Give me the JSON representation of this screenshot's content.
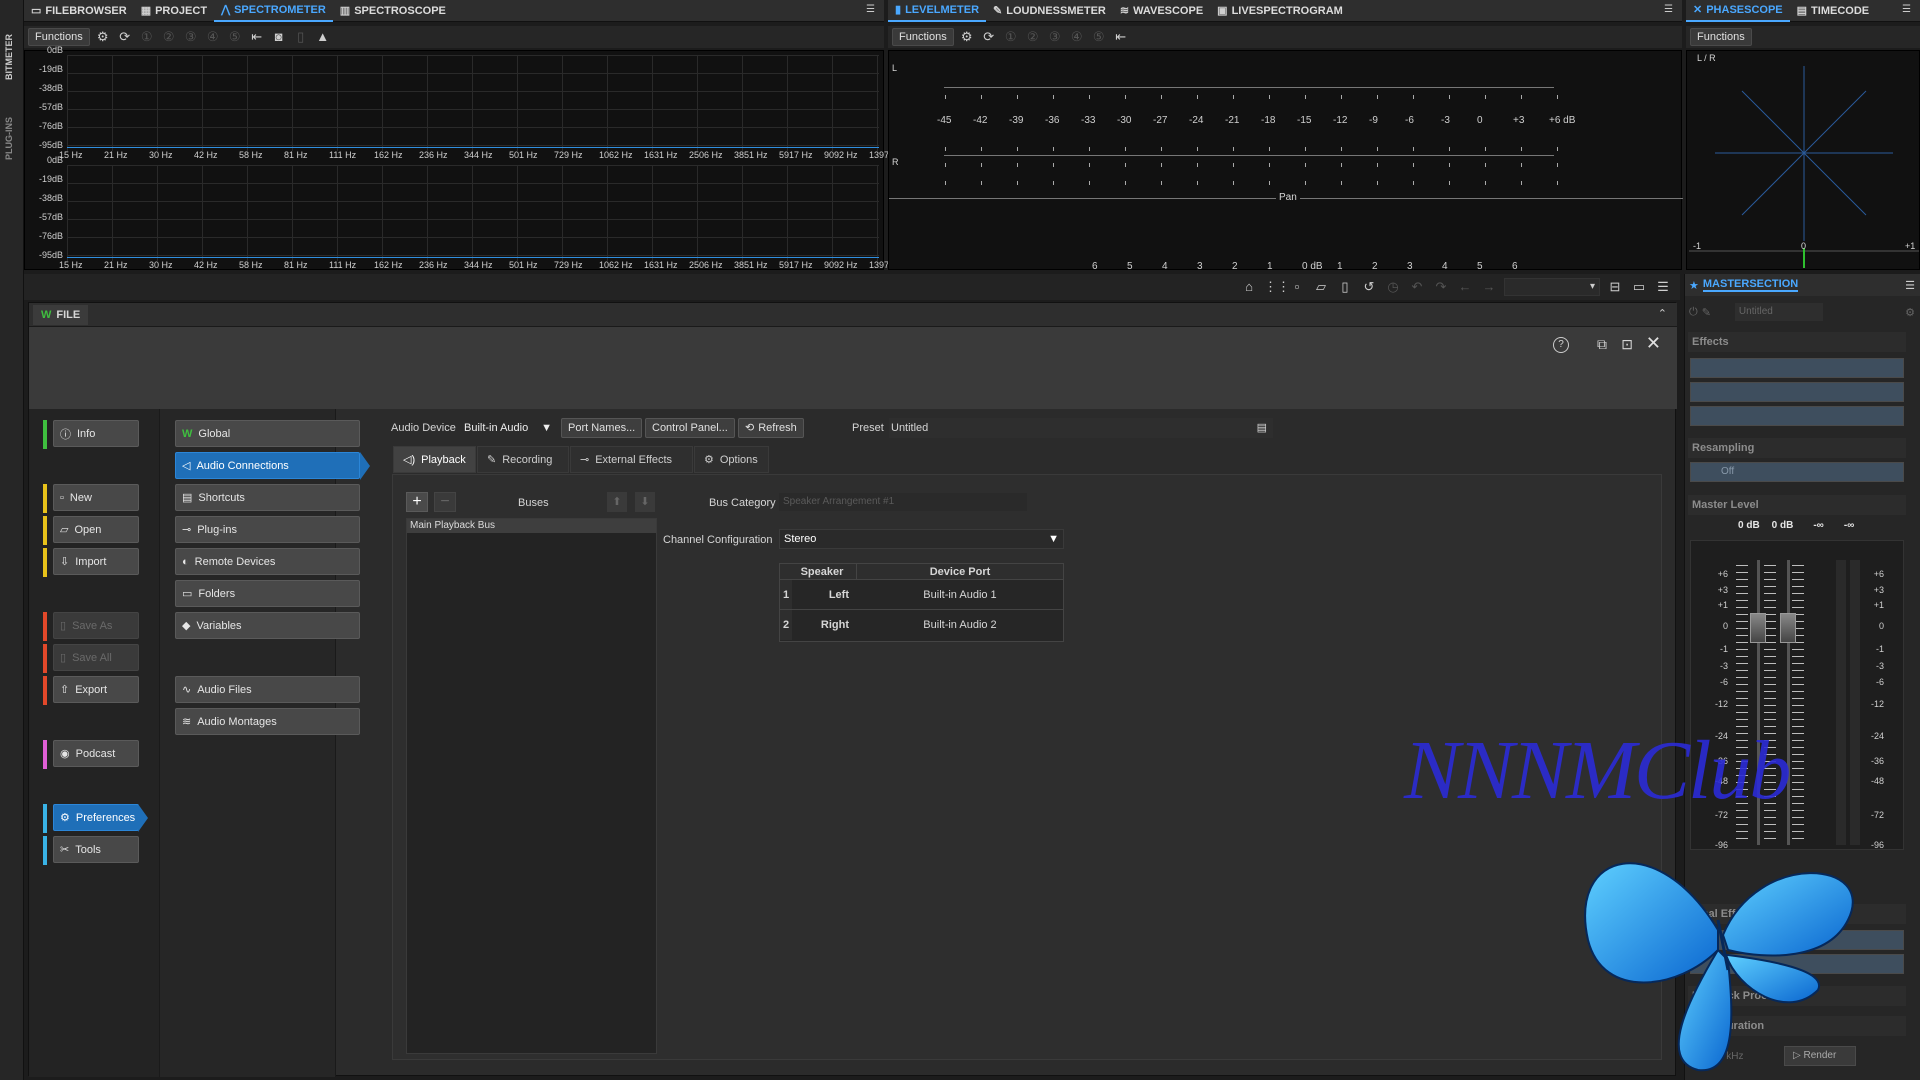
{
  "left_rail": {
    "labels": [
      "BITMETER",
      "PLUG-INS"
    ]
  },
  "top_left": {
    "tabs": [
      {
        "label": "FILEBROWSER",
        "icon": "folder-icon"
      },
      {
        "label": "PROJECT",
        "icon": "grid-icon"
      },
      {
        "label": "SPECTROMETER",
        "icon": "spectrum-icon",
        "active": true
      },
      {
        "label": "SPECTROSCOPE",
        "icon": "bars-icon"
      }
    ],
    "functions_label": "Functions",
    "upper_db": [
      "0dB",
      "-19dB",
      "-38dB",
      "-57dB",
      "-76dB",
      "-95dB"
    ],
    "lower_db": [
      "0dB",
      "-19dB",
      "-38dB",
      "-57dB",
      "-76dB",
      "-95dB"
    ],
    "freqs": [
      "15 Hz",
      "21 Hz",
      "30 Hz",
      "42 Hz",
      "58 Hz",
      "81 Hz",
      "111 Hz",
      "162 Hz",
      "236 Hz",
      "344 Hz",
      "501 Hz",
      "729 Hz",
      "1062 Hz",
      "1631 Hz",
      "2506 Hz",
      "3851 Hz",
      "5917 Hz",
      "9092 Hz",
      "13970 Hz"
    ]
  },
  "top_mid": {
    "tabs": [
      {
        "label": "LEVELMETER",
        "icon": "level-icon",
        "active": true
      },
      {
        "label": "LOUDNESSMETER",
        "icon": "pen-icon"
      },
      {
        "label": "WAVESCOPE",
        "icon": "wave-icon"
      },
      {
        "label": "LIVESPECTROGRAM",
        "icon": "image-icon"
      }
    ],
    "functions_label": "Functions",
    "channel_l": "L",
    "channel_r": "R",
    "db_scale": [
      "-45",
      "-42",
      "-39",
      "-36",
      "-33",
      "-30",
      "-27",
      "-24",
      "-21",
      "-18",
      "-15",
      "-12",
      "-9",
      "-6",
      "-3",
      "0",
      "+3",
      "+6 dB"
    ],
    "pan_label": "Pan",
    "pan_scale": [
      "6",
      "5",
      "4",
      "3",
      "2",
      "1",
      "0 dB",
      "1",
      "2",
      "3",
      "4",
      "5",
      "6"
    ]
  },
  "top_right": {
    "tabs": [
      {
        "label": "PHASESCOPE",
        "icon": "phase-icon",
        "active": true
      },
      {
        "label": "TIMECODE",
        "icon": "timecode-icon"
      }
    ],
    "functions_label": "Functions",
    "lr_label": "L / R",
    "axis": [
      "-1",
      "0",
      "+1"
    ]
  },
  "file": {
    "title": "FILE",
    "nav": [
      {
        "label": "Info",
        "icon": "info-icon",
        "color": "#3fbf3f"
      },
      {
        "label": "New",
        "icon": "new-file-icon",
        "color": "#e8c21a"
      },
      {
        "label": "Open",
        "icon": "open-folder-icon",
        "color": "#e8c21a"
      },
      {
        "label": "Import",
        "icon": "import-icon",
        "color": "#e8c21a"
      },
      {
        "label": "Save As",
        "icon": "save-as-icon",
        "color": "#e2482a",
        "disabled": true
      },
      {
        "label": "Save All",
        "icon": "save-all-icon",
        "color": "#e2482a",
        "disabled": true
      },
      {
        "label": "Export",
        "icon": "export-icon",
        "color": "#e2482a"
      },
      {
        "label": "Podcast",
        "icon": "podcast-icon",
        "color": "#e05fd6"
      },
      {
        "label": "Preferences",
        "icon": "gear-icon",
        "color": "#39b3e6",
        "active": true
      },
      {
        "label": "Tools",
        "icon": "tools-icon",
        "color": "#39b3e6"
      }
    ],
    "pref": [
      {
        "label": "Global",
        "icon": "wavelab-icon"
      },
      {
        "label": "Audio Connections",
        "icon": "speaker-icon",
        "active": true
      },
      {
        "label": "Shortcuts",
        "icon": "keyboard-icon"
      },
      {
        "label": "Plug-ins",
        "icon": "plugin-icon"
      },
      {
        "label": "Remote Devices",
        "icon": "remote-icon"
      },
      {
        "label": "Folders",
        "icon": "folder-icon"
      },
      {
        "label": "Variables",
        "icon": "tag-icon"
      },
      {
        "label": "Audio Files",
        "icon": "audio-file-icon"
      },
      {
        "label": "Audio Montages",
        "icon": "montage-icon"
      }
    ],
    "audio_device_label": "Audio Device",
    "audio_device_value": "Built-in Audio",
    "port_names": "Port Names...",
    "control_panel": "Control Panel...",
    "refresh": "Refresh",
    "preset_label": "Preset",
    "preset_value": "Untitled",
    "tabs": [
      {
        "label": "Playback",
        "icon": "speaker-icon",
        "active": true
      },
      {
        "label": "Recording",
        "icon": "mic-icon"
      },
      {
        "label": "External Effects",
        "icon": "plugin-icon"
      },
      {
        "label": "Options",
        "icon": "gear-icon"
      }
    ],
    "buses_label": "Buses",
    "bus_item": "Main Playback Bus",
    "bus_category_label": "Bus Category",
    "bus_category_value": "Speaker Arrangement #1",
    "channel_config_label": "Channel Configuration",
    "channel_config_value": "Stereo",
    "table": {
      "headers": [
        "Speaker",
        "Device Port"
      ],
      "rows": [
        [
          "1",
          "Left",
          "Built-in Audio 1"
        ],
        [
          "2",
          "Right",
          "Built-in Audio 2"
        ]
      ]
    }
  },
  "master": {
    "title": "MASTERSECTION",
    "preset": "Untitled",
    "effects_label": "Effects",
    "resampling_label": "Resampling",
    "resampling_value": "Off",
    "master_level_label": "Master Level",
    "levels": [
      "0 dB",
      "0 dB",
      "-∞",
      "-∞"
    ],
    "scale": [
      "+6",
      "+3",
      "+1",
      "0",
      "-1",
      "-3",
      "-6",
      "-12",
      "-24",
      "-36",
      "-48",
      "-72",
      "-96"
    ],
    "final_effects_label": "Final Effects / Dithering",
    "playback_processing_label": "Playback Processing",
    "configuration_label": "Configuration",
    "sample_rate": "44.1 kHz",
    "render": "Render"
  },
  "watermark": "NNNMClub"
}
